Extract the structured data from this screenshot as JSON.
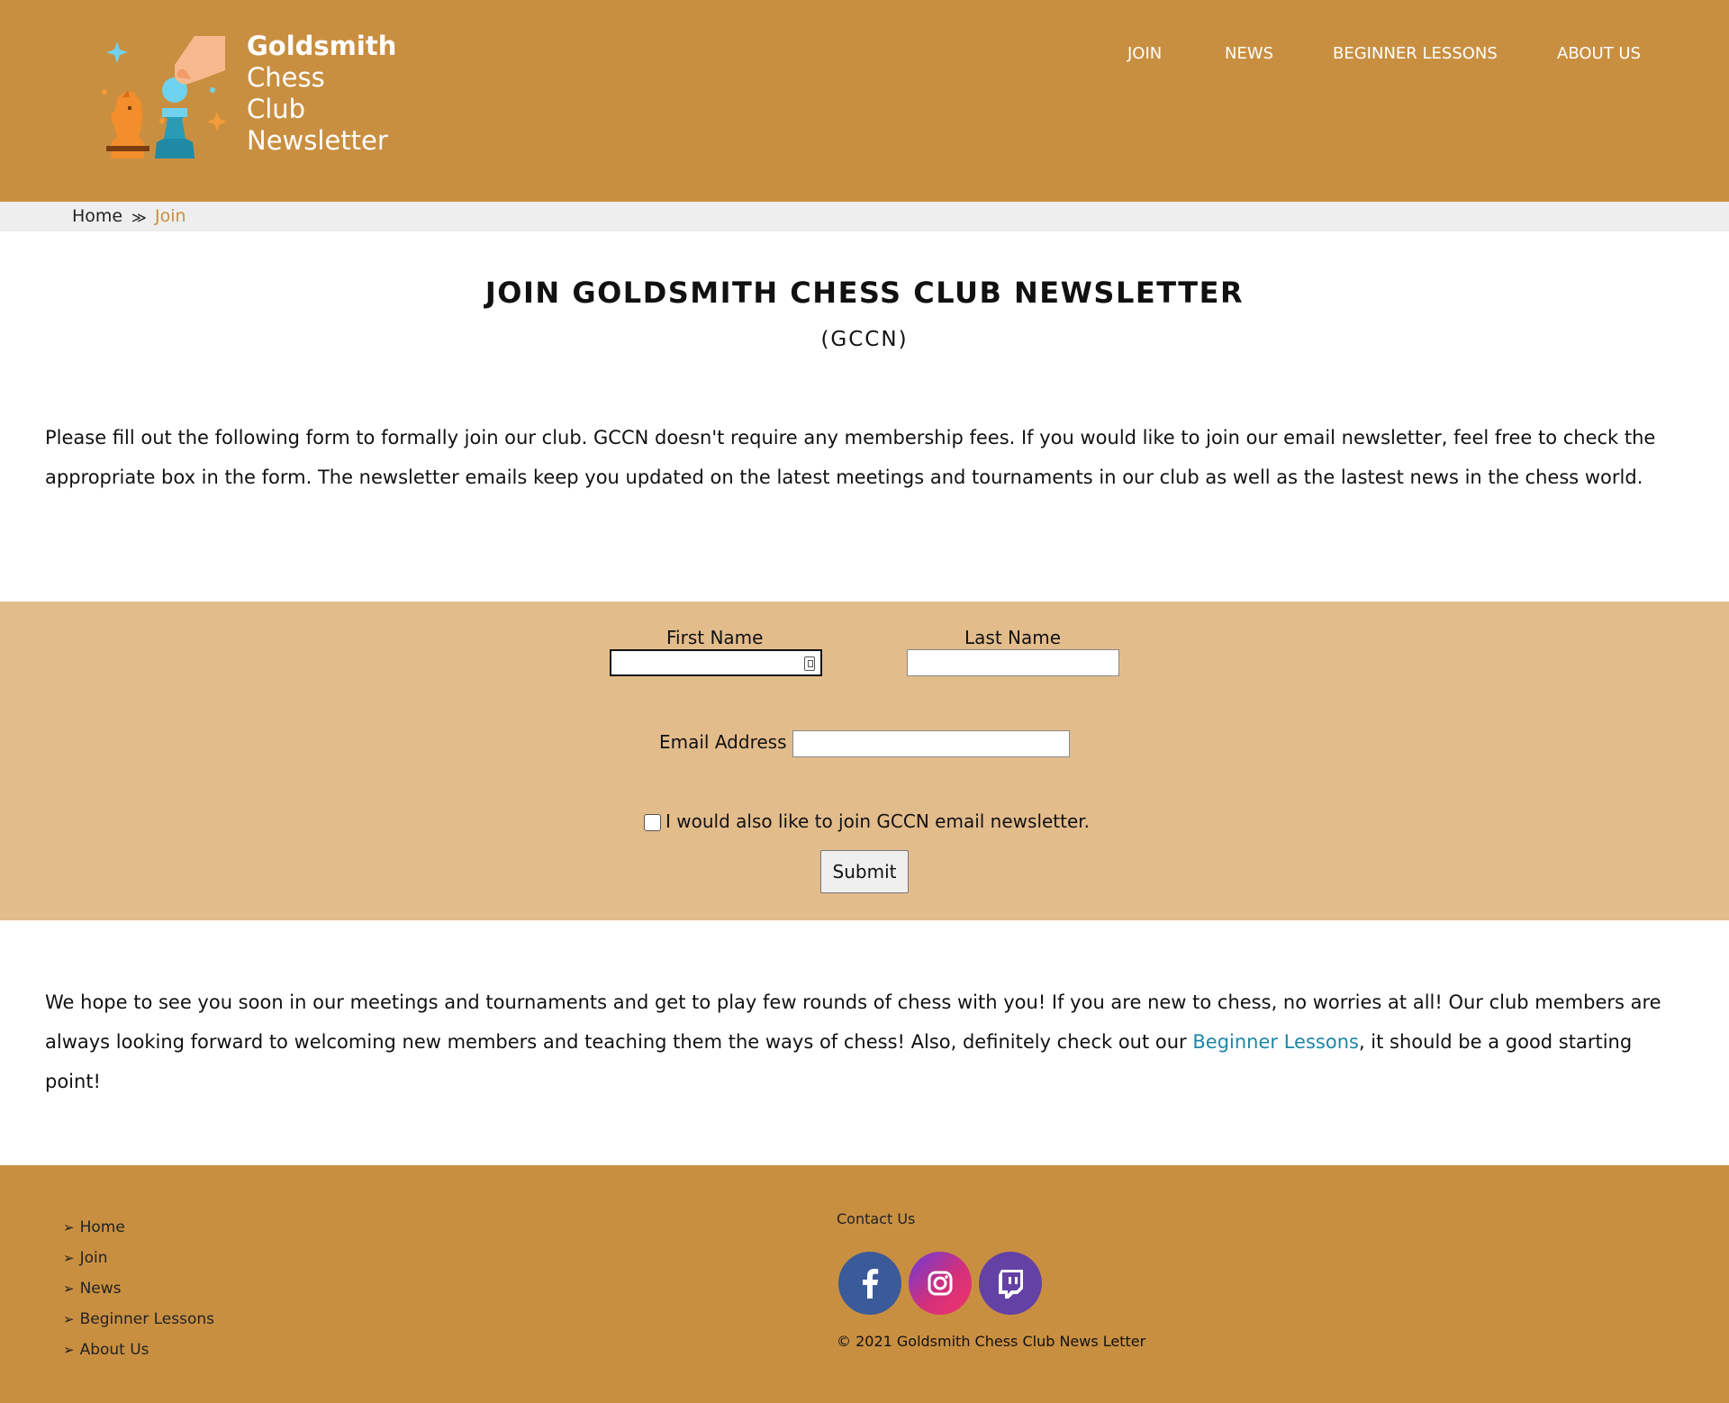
{
  "logo": {
    "brand": "Goldsmith",
    "line2": "Chess",
    "line3": "Club",
    "line4": "Newsletter"
  },
  "nav": {
    "items": [
      "JOIN",
      "NEWS",
      "BEGINNER LESSONS",
      "ABOUT US"
    ]
  },
  "breadcrumb": {
    "home": "Home",
    "separator": "≫",
    "current": "Join"
  },
  "page": {
    "title": "JOIN GOLDSMITH CHESS CLUB NEWSLETTER",
    "subtitle": "(GCCN)",
    "intro": "Please fill out the following form to formally join our club. GCCN doesn't require any membership fees. If you would like to join our email newsletter, feel free to check the appropriate box in the form. The newsletter emails keep you updated on the latest meetings and tournaments in our club as well as the lastest news in the chess world.",
    "outro_before_link": "We hope to see you soon in our meetings and tournaments and get to play few rounds of chess with you! If you are new to chess, no worries at all! Our club members are always looking forward to welcoming new members and teaching them the ways of chess! Also, definitely check out our ",
    "outro_link": "Beginner Lessons",
    "outro_after_link": ", it should be a good starting point!"
  },
  "form": {
    "first_name_label": "First Name",
    "first_name_value": "",
    "last_name_label": "Last Name",
    "last_name_value": "",
    "email_label": "Email Address",
    "email_value": "",
    "newsletter_label": "I would also like to join GCCN email newsletter.",
    "newsletter_checked": false,
    "submit_label": "Submit"
  },
  "footer": {
    "links": [
      "Home",
      "Join",
      "News",
      "Beginner Lessons",
      "About Us"
    ],
    "link_arrow": "➢",
    "contact_label": "Contact Us",
    "social": [
      {
        "name": "facebook-icon",
        "color": "#3b5a9a"
      },
      {
        "name": "instagram-icon",
        "color": "#d3307a"
      },
      {
        "name": "twitch-icon",
        "color": "#6441a5"
      }
    ],
    "copyright": "© 2021 Goldsmith Chess Club News Letter"
  },
  "colors": {
    "header_bg": "#c98f41",
    "form_bg": "#e3bc8c",
    "breadcrumb_bg": "#eeeeee",
    "link": "#1e86a6",
    "accent": "#c98f41"
  }
}
